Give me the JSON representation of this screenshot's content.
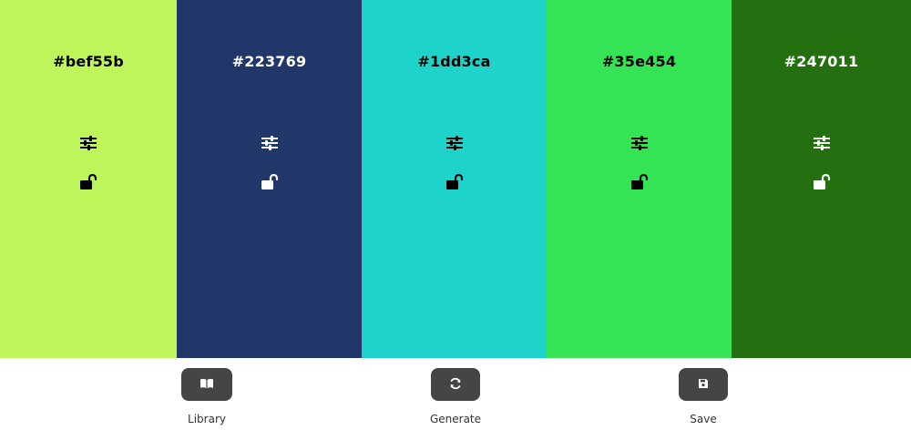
{
  "swatches": [
    {
      "hex": "#bef55b",
      "color": "#bef55b",
      "text_color": "#000000",
      "adjust_icon": "sliders-icon",
      "lock_icon": "unlock-icon"
    },
    {
      "hex": "#223769",
      "color": "#223769",
      "text_color": "#ffffff",
      "adjust_icon": "sliders-icon",
      "lock_icon": "unlock-icon"
    },
    {
      "hex": "#1dd3ca",
      "color": "#1dd3ca",
      "text_color": "#000000",
      "adjust_icon": "sliders-icon",
      "lock_icon": "unlock-icon"
    },
    {
      "hex": "#35e454",
      "color": "#35e454",
      "text_color": "#000000",
      "adjust_icon": "sliders-icon",
      "lock_icon": "unlock-icon"
    },
    {
      "hex": "#247011",
      "color": "#247011",
      "text_color": "#ffffff",
      "adjust_icon": "sliders-icon",
      "lock_icon": "unlock-icon"
    }
  ],
  "controls": {
    "library": {
      "label": "Library",
      "icon": "book-icon"
    },
    "generate": {
      "label": "Generate",
      "icon": "refresh-icon"
    },
    "save": {
      "label": "Save",
      "icon": "floppy-disk-icon"
    }
  },
  "colors": {
    "button_bg": "#454545",
    "label_text": "#333333"
  }
}
